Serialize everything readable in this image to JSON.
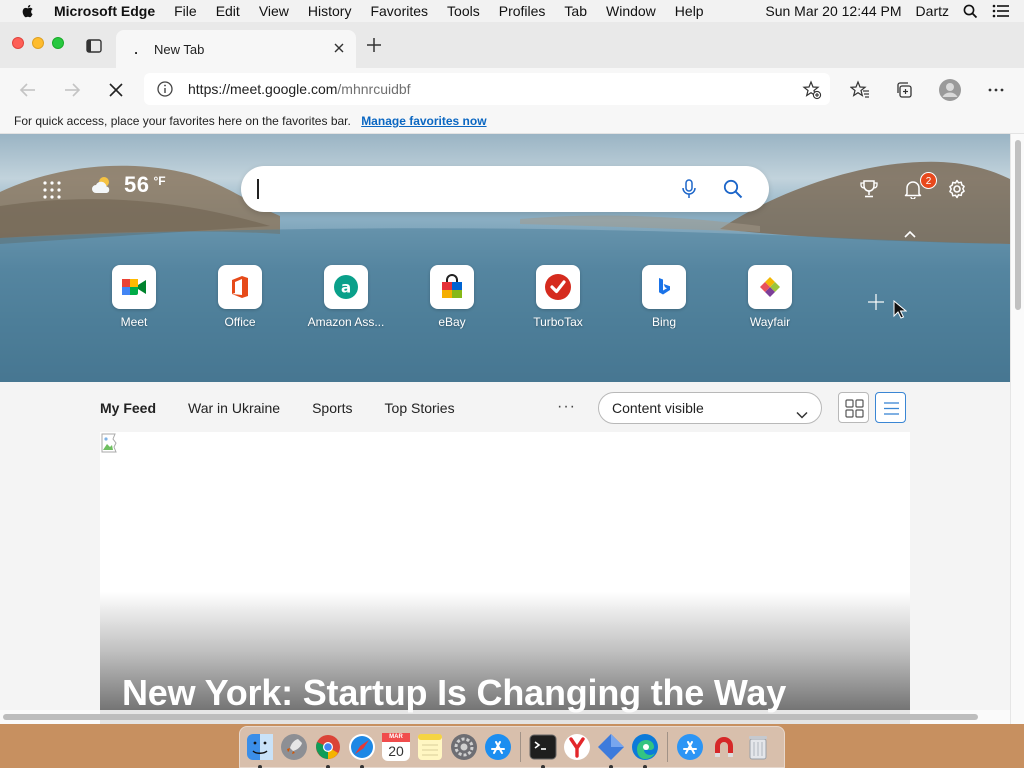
{
  "menubar": {
    "app_name": "Microsoft Edge",
    "items": [
      "File",
      "Edit",
      "View",
      "History",
      "Favorites",
      "Tools",
      "Profiles",
      "Tab",
      "Window",
      "Help"
    ],
    "datetime": "Sun Mar 20  12:44 PM",
    "user": "Dartz"
  },
  "browser": {
    "tab_title": "New Tab",
    "tab_favicon": ".",
    "url_host": "https://meet.google.com",
    "url_path": "/mhnrcuidbf",
    "favorites_bar_text": "For quick access, place your favorites here on the favorites bar.",
    "favorites_bar_link": "Manage favorites now"
  },
  "newtab": {
    "weather_temp": "56",
    "weather_unit": "°F",
    "notification_count": "2",
    "quick_links": [
      {
        "label": "Meet"
      },
      {
        "label": "Office"
      },
      {
        "label": "Amazon Ass..."
      },
      {
        "label": "eBay"
      },
      {
        "label": "TurboTax"
      },
      {
        "label": "Bing"
      },
      {
        "label": "Wayfair"
      }
    ]
  },
  "feed": {
    "tabs": [
      "My Feed",
      "War in Ukraine",
      "Sports",
      "Top Stories"
    ],
    "more_label": "···",
    "content_select_value": "Content visible",
    "headline": "New York: Startup Is Changing the Way"
  },
  "dock": {
    "calendar_day": "20",
    "calendar_month": "MAR",
    "apps": [
      "finder",
      "launchpad",
      "chrome",
      "safari",
      "calendar",
      "notes",
      "system-preferences",
      "app-store",
      "terminal",
      "yandex",
      "tool",
      "edge",
      "app-store-2",
      "magnet",
      "trash"
    ]
  },
  "colors": {
    "accent": "#0b67c2",
    "badge": "#e8491d",
    "list_view_border": "#3a86d4"
  }
}
